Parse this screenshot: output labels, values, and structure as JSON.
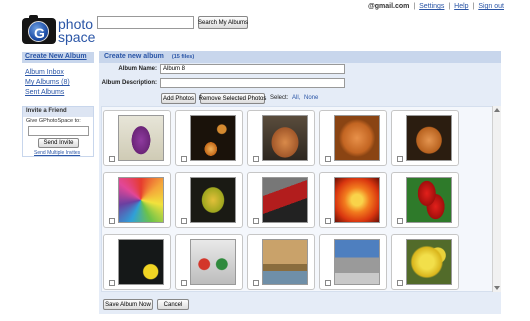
{
  "header": {
    "email": "@gmail.com",
    "settings_link": "Settings",
    "help_link": "Help",
    "signout_link": "Sign out",
    "separator": "|"
  },
  "logo": {
    "word1": "photo",
    "word2": "space",
    "letter": "G"
  },
  "search": {
    "value": "",
    "button": "Search My Albums"
  },
  "sidebar": {
    "create_album": "Create New Album",
    "links": [
      "Album Inbox",
      "My Albums (8)",
      "Sent Albums"
    ]
  },
  "invite": {
    "title": "Invite a Friend",
    "text": "Give GPhotoSpace to:",
    "send_button": "Send Invite",
    "multiple_link": "Send Multiple Invites"
  },
  "main": {
    "title": "Create new album",
    "count": "(15 files)",
    "album_name_label": "Album Name:",
    "album_name_value": "Album 8",
    "album_desc_label": "Album Description:",
    "album_desc_value": "",
    "add_photos_button": "Add Photos",
    "remove_button": "Remove Selected Photos",
    "select_label": "Select:",
    "select_all": "All,",
    "select_none": "None",
    "save_button": "Save Album Now",
    "cancel_button": "Cancel"
  },
  "photos": [
    {
      "icon": "purple-iris-photo",
      "checked": false
    },
    {
      "icon": "orange-flower-photo",
      "checked": false
    },
    {
      "icon": "cat-photo",
      "checked": false
    },
    {
      "icon": "cat-face-photo",
      "checked": false
    },
    {
      "icon": "orange-kitten-photo",
      "checked": false
    },
    {
      "icon": "colored-pencils-photo",
      "checked": false
    },
    {
      "icon": "autumn-leaf-photo",
      "checked": false
    },
    {
      "icon": "red-car-photo",
      "checked": false
    },
    {
      "icon": "orange-flower-closeup-photo",
      "checked": false
    },
    {
      "icon": "red-tulips-photo",
      "checked": false
    },
    {
      "icon": "rubber-duck-photo",
      "checked": false
    },
    {
      "icon": "toy-figures-photo",
      "checked": false
    },
    {
      "icon": "coastal-landscape-photo",
      "checked": false
    },
    {
      "icon": "skateboarder-photo",
      "checked": false
    },
    {
      "icon": "yellow-roses-photo",
      "checked": false
    }
  ]
}
